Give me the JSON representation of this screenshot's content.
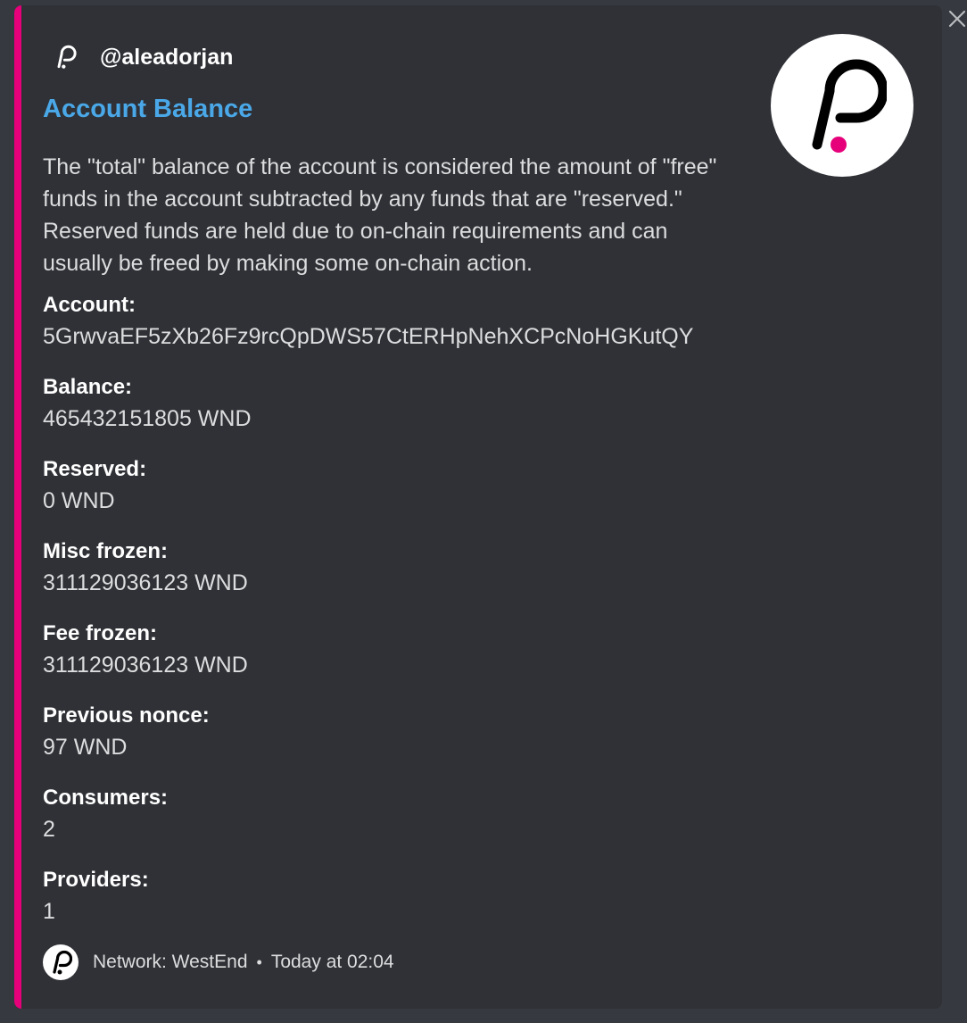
{
  "embed": {
    "accent_color": "#e6007a",
    "author": {
      "icon": "polkadot-logo-icon",
      "name": "@aleadorjan"
    },
    "title": "Account Balance",
    "description": "The \"total\" balance of the account is considered the amount of \"free\" funds in the account subtracted by any funds that are \"reserved.\" Reserved funds are held due to on-chain requirements and can usually be freed by making some on-chain action.",
    "thumbnail": "polkadot-logo-icon",
    "fields": [
      {
        "name": "Account:",
        "value": "5GrwvaEF5zXb26Fz9rcQpDWS57CtERHpNehXCPcNoHGKutQY"
      },
      {
        "name": "Balance:",
        "value": "465432151805 WND"
      },
      {
        "name": "Reserved:",
        "value": "0 WND"
      },
      {
        "name": "Misc frozen:",
        "value": "311129036123 WND"
      },
      {
        "name": "Fee frozen:",
        "value": "311129036123 WND"
      },
      {
        "name": "Previous nonce:",
        "value": "97 WND"
      },
      {
        "name": "Consumers:",
        "value": "2"
      },
      {
        "name": "Providers:",
        "value": "1"
      }
    ],
    "footer": {
      "icon": "polkadot-logo-icon",
      "text": "Network: WestEnd",
      "separator": "•",
      "timestamp": "Today at 02:04"
    }
  },
  "close_icon": "close-icon"
}
